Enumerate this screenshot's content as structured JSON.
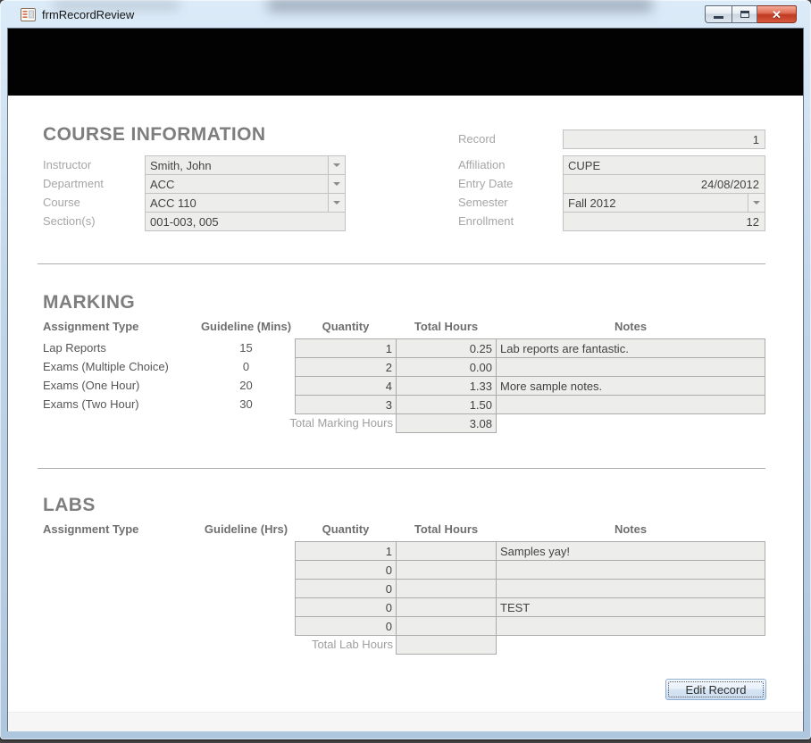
{
  "window": {
    "title": "frmRecordReview"
  },
  "course_information": {
    "title": "COURSE INFORMATION",
    "fields_left": [
      {
        "label": "Instructor",
        "value": "Smith, John"
      },
      {
        "label": "Department",
        "value": "ACC"
      },
      {
        "label": "Course",
        "value": "ACC 110"
      },
      {
        "label": "Section(s)",
        "value": "001-003, 005"
      }
    ],
    "record": {
      "label": "Record",
      "value": "1"
    },
    "fields_right": [
      {
        "label": "Affiliation",
        "value": "CUPE"
      },
      {
        "label": "Entry Date",
        "value": "24/08/2012"
      },
      {
        "label": "Semester",
        "value": "Fall 2012"
      },
      {
        "label": "Enrollment",
        "value": "12"
      }
    ]
  },
  "marking": {
    "title": "MARKING",
    "headers": {
      "assignment_type": "Assignment Type",
      "guideline": "Guideline (Mins)",
      "quantity": "Quantity",
      "total_hours": "Total Hours",
      "notes": "Notes"
    },
    "rows": [
      {
        "type": "Lap Reports",
        "guideline": "15",
        "quantity": "1",
        "total_hours": "0.25",
        "notes": "Lab reports are fantastic."
      },
      {
        "type": "Exams (Multiple Choice)",
        "guideline": "0",
        "quantity": "2",
        "total_hours": "0.00",
        "notes": ""
      },
      {
        "type": "Exams (One Hour)",
        "guideline": "20",
        "quantity": "4",
        "total_hours": "1.33",
        "notes": "More sample notes."
      },
      {
        "type": "Exams (Two Hour)",
        "guideline": "30",
        "quantity": "3",
        "total_hours": "1.50",
        "notes": ""
      }
    ],
    "total": {
      "label": "Total Marking Hours",
      "value": "3.08"
    }
  },
  "labs": {
    "title": "LABS",
    "headers": {
      "assignment_type": "Assignment Type",
      "guideline": "Guideline (Hrs)",
      "quantity": "Quantity",
      "total_hours": "Total Hours",
      "notes": "Notes"
    },
    "rows": [
      {
        "type": "",
        "guideline": "",
        "quantity": "1",
        "total_hours": "",
        "notes": "Samples yay!"
      },
      {
        "type": "",
        "guideline": "",
        "quantity": "0",
        "total_hours": "",
        "notes": ""
      },
      {
        "type": "",
        "guideline": "",
        "quantity": "0",
        "total_hours": "",
        "notes": ""
      },
      {
        "type": "",
        "guideline": "",
        "quantity": "0",
        "total_hours": "",
        "notes": "TEST"
      },
      {
        "type": "",
        "guideline": "",
        "quantity": "0",
        "total_hours": "",
        "notes": ""
      }
    ],
    "total": {
      "label": "Total Lab Hours",
      "value": ""
    }
  },
  "actions": {
    "edit_record": "Edit Record"
  },
  "colors": {
    "titlebar_blue": "#c6daed",
    "header_band": "#020202",
    "field_bg": "#edeeec",
    "close_button_red": "#c03920",
    "button_border_blue": "#8eafd3",
    "section_title_gray": "#7e7e7e"
  }
}
